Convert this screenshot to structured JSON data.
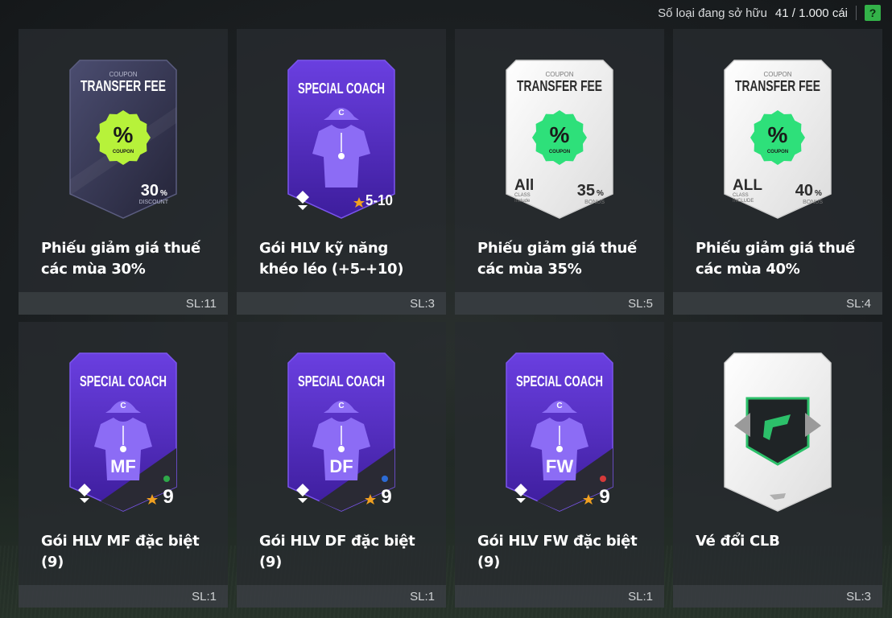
{
  "header": {
    "owned_label": "Số loại đang sở hữu",
    "owned_count": "41 / 1.000 cái",
    "help_label": "?"
  },
  "items": [
    {
      "name": "Phiếu giảm giá thuế các mùa 30%",
      "qty": "SL:11",
      "card": "coupon-dark",
      "coupon_small": "COUPON",
      "coupon_title": "TRANSFER FEE",
      "badge": "%",
      "badge_sub": "COUPON",
      "value": "30",
      "value_unit": "%",
      "value_sub": "DISCOUNT"
    },
    {
      "name": "Gói HLV kỹ năng khéo léo (+5-+10)",
      "qty": "SL:3",
      "card": "coach-purple",
      "coach_title": "SPECIAL COACH",
      "cap_letter": "C",
      "range": "5-10"
    },
    {
      "name": "Phiếu giảm giá thuế các mùa 35%",
      "qty": "SL:5",
      "card": "coupon-white",
      "coupon_small": "COUPON",
      "coupon_title": "TRANSFER FEE",
      "badge": "%",
      "badge_sub": "COUPON",
      "class_main": "All",
      "class_sub1": "CLASS",
      "class_sub2": "Include",
      "value": "35",
      "value_unit": "%",
      "value_sub": "BONUS"
    },
    {
      "name": "Phiếu giảm giá thuế các mùa 40%",
      "qty": "SL:4",
      "card": "coupon-white",
      "coupon_small": "COUPON",
      "coupon_title": "TRANSFER FEE",
      "badge": "%",
      "badge_sub": "COUPON",
      "class_main": "ALL",
      "class_sub1": "CLASS",
      "class_sub2": "INCLUDE",
      "value": "40",
      "value_unit": "%",
      "value_sub": "BONUS"
    },
    {
      "name": "Gói HLV MF đặc biệt (9)",
      "qty": "SL:1",
      "card": "coach-purple",
      "coach_title": "SPECIAL COACH",
      "cap_letter": "C",
      "position": "MF",
      "dot_color": "#2fa84a",
      "level": "9"
    },
    {
      "name": "Gói HLV DF đặc biệt (9)",
      "qty": "SL:1",
      "card": "coach-purple",
      "coach_title": "SPECIAL COACH",
      "cap_letter": "C",
      "position": "DF",
      "dot_color": "#2c6bd6",
      "level": "9"
    },
    {
      "name": "Gói HLV FW đặc biệt (9)",
      "qty": "SL:1",
      "card": "coach-purple",
      "coach_title": "SPECIAL COACH",
      "cap_letter": "C",
      "position": "FW",
      "dot_color": "#d63a3a",
      "level": "9"
    },
    {
      "name": "Vé đổi CLB",
      "qty": "SL:3",
      "card": "club-ticket"
    }
  ]
}
